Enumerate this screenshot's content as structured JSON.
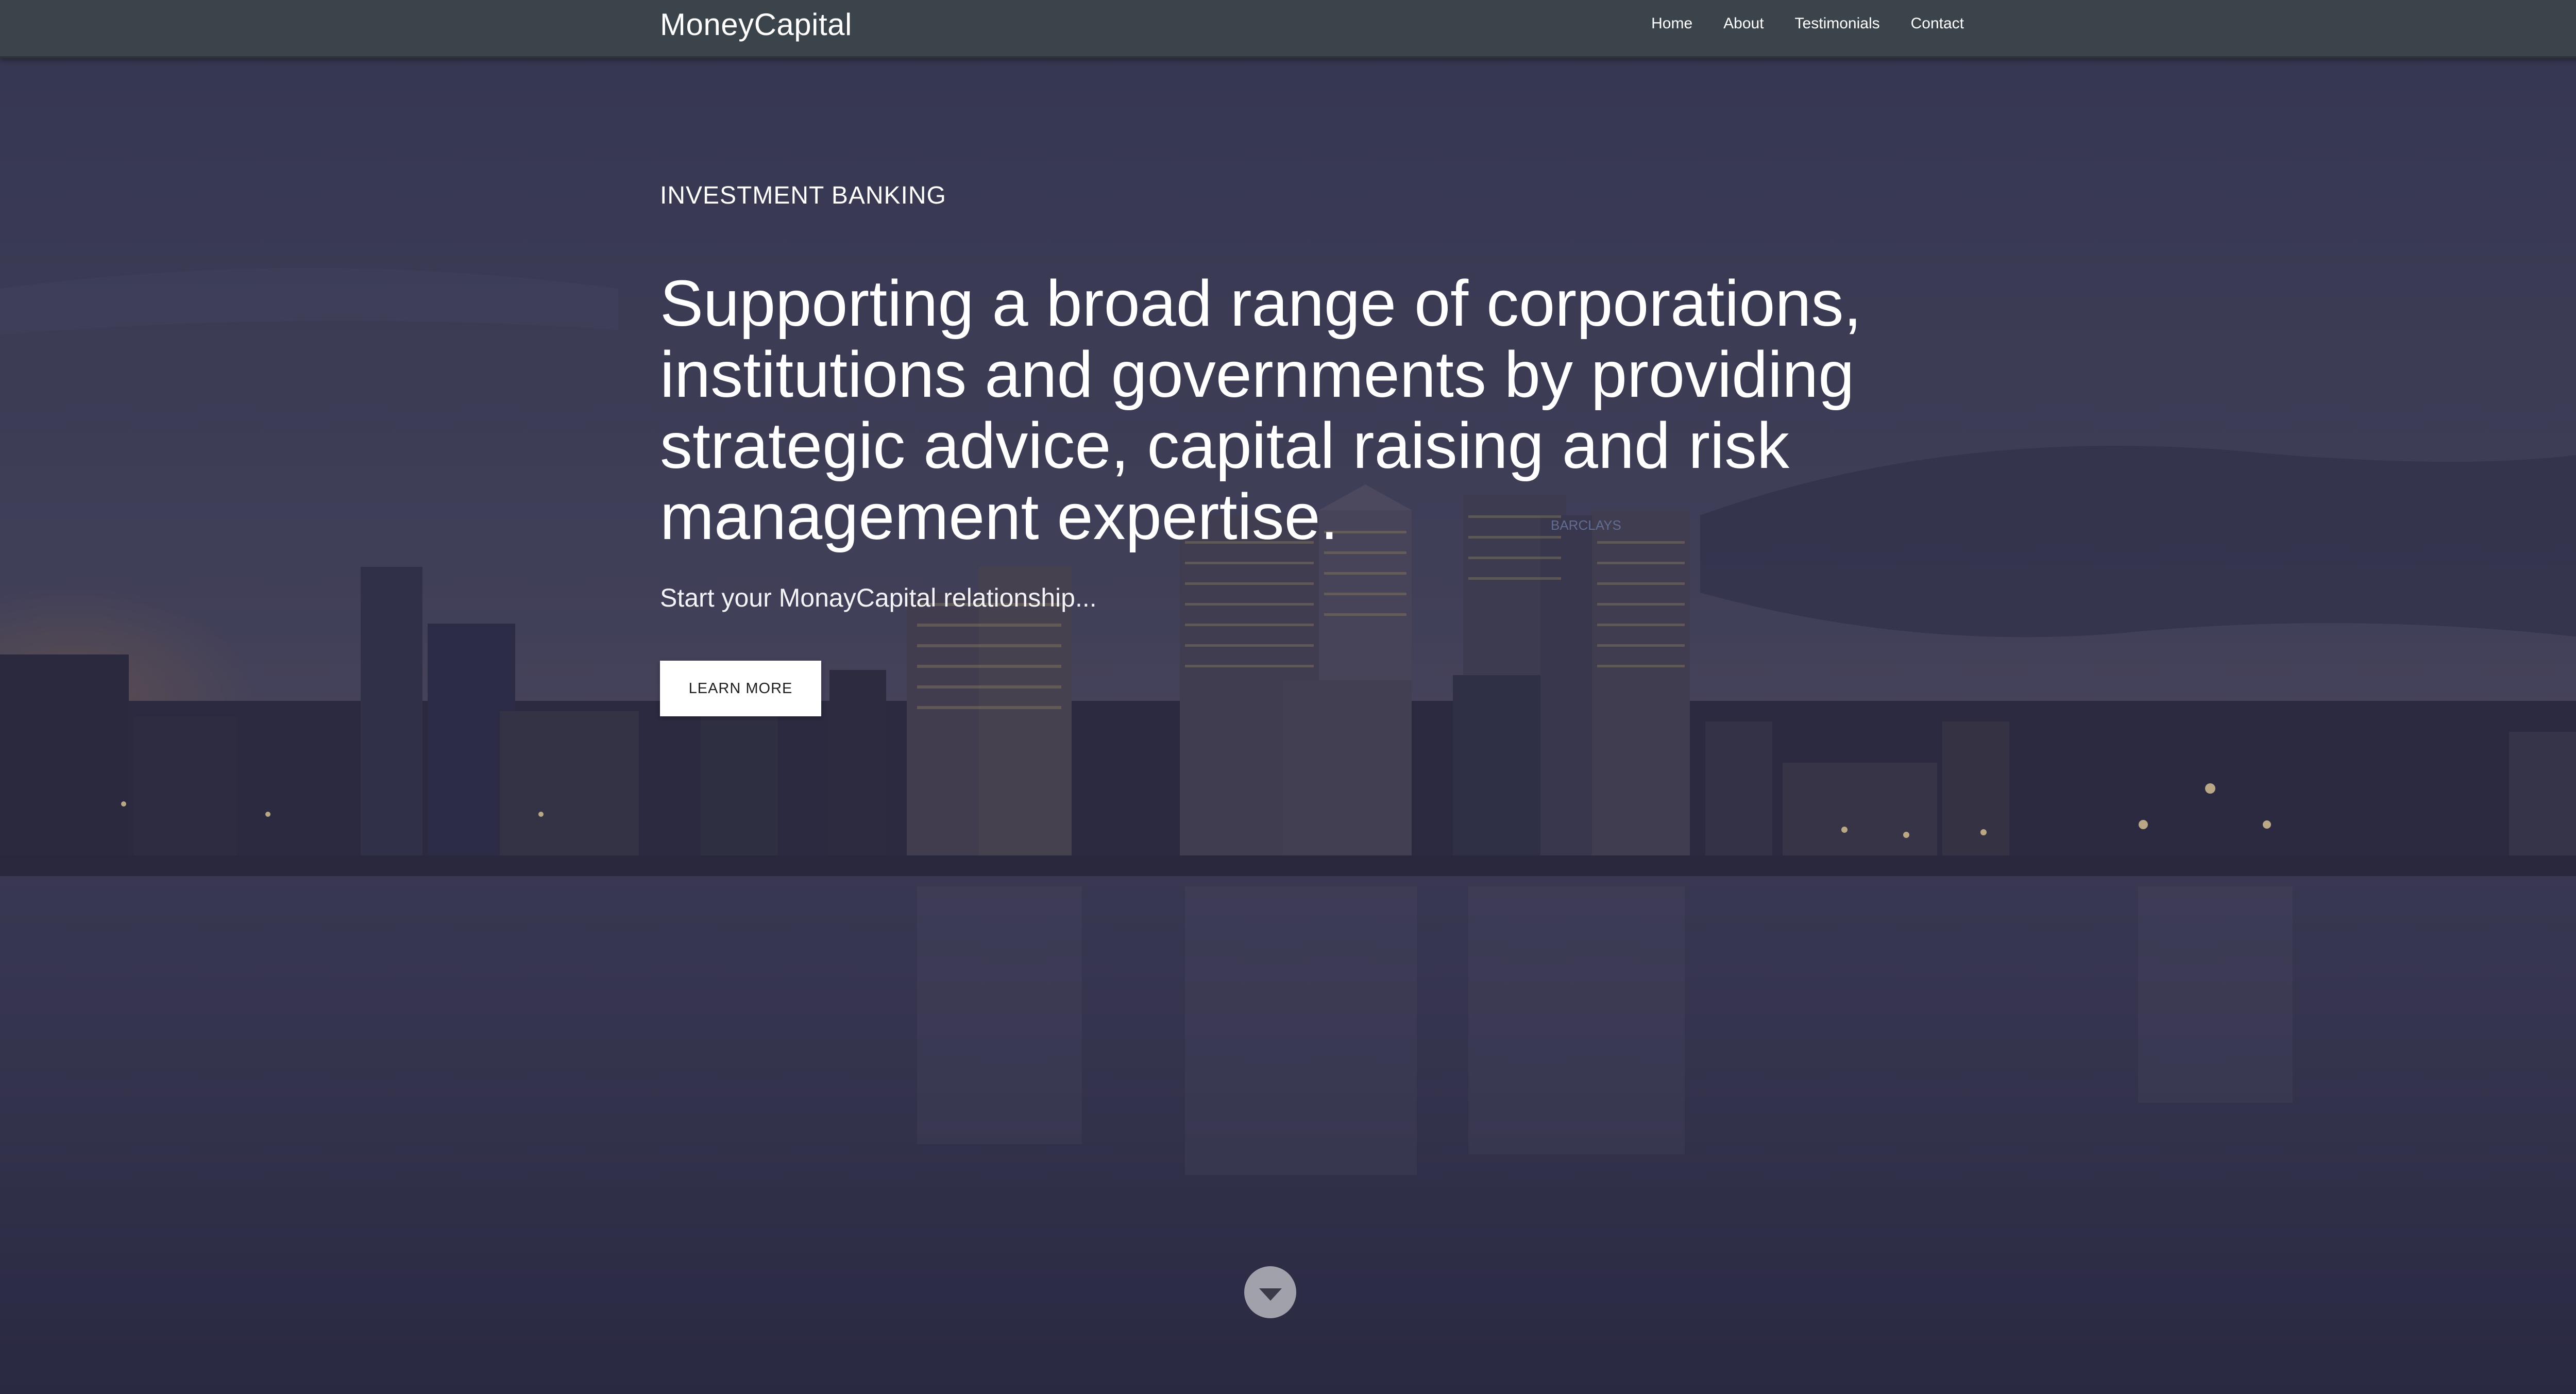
{
  "navbar": {
    "brand": "MoneyCapital",
    "links": [
      "Home",
      "About",
      "Testimonials",
      "Contact"
    ]
  },
  "hero": {
    "eyebrow": "INVESTMENT BANKING",
    "headline": "Supporting a broad range of corporations, institutions and governments by providing strategic advice, capital raising and risk management expertise.",
    "subtext": "Start your MonayCapital relationship...",
    "cta_label": "LEARN MORE",
    "scroll_icon": "chevron-down-icon"
  },
  "background": {
    "building_sign": "BARCLAYS"
  },
  "colors": {
    "navbar": "#3c444b",
    "overlay": "#2f2f45",
    "button": "#ffffff"
  }
}
